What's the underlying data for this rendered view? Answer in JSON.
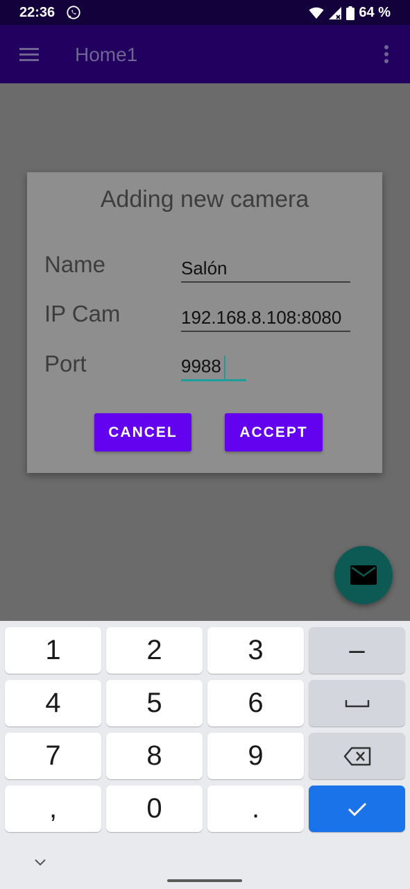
{
  "status_bar": {
    "time": "22:36",
    "battery": "64 %",
    "icons": [
      "whatsapp-icon",
      "wifi-icon",
      "signal-icon",
      "battery-icon"
    ]
  },
  "app_bar": {
    "title": "Home1",
    "icons": [
      "menu-icon",
      "more-vert-icon"
    ]
  },
  "dialog": {
    "title": "Adding new camera",
    "fields": [
      {
        "label": "Name",
        "value": "Salón"
      },
      {
        "label": "IP Cam",
        "value": "192.168.8.108:8080"
      },
      {
        "label": "Port",
        "value": "9988"
      }
    ],
    "cancel_label": "CANCEL",
    "accept_label": "ACCEPT"
  },
  "fab": {
    "icon": "mail-icon"
  },
  "keyboard": {
    "rows": [
      [
        "1",
        "2",
        "3",
        "–"
      ],
      [
        "4",
        "5",
        "6",
        "space"
      ],
      [
        "7",
        "8",
        "9",
        "backspace"
      ],
      [
        ",",
        "0",
        ".",
        "enter"
      ]
    ]
  },
  "colors": {
    "status_bar": "#13013c",
    "app_bar": "#22005f",
    "primary_button": "#6202ee",
    "accent": "#1c9e9a",
    "fab": "#0d5a55",
    "enter_key": "#1a73e8"
  }
}
